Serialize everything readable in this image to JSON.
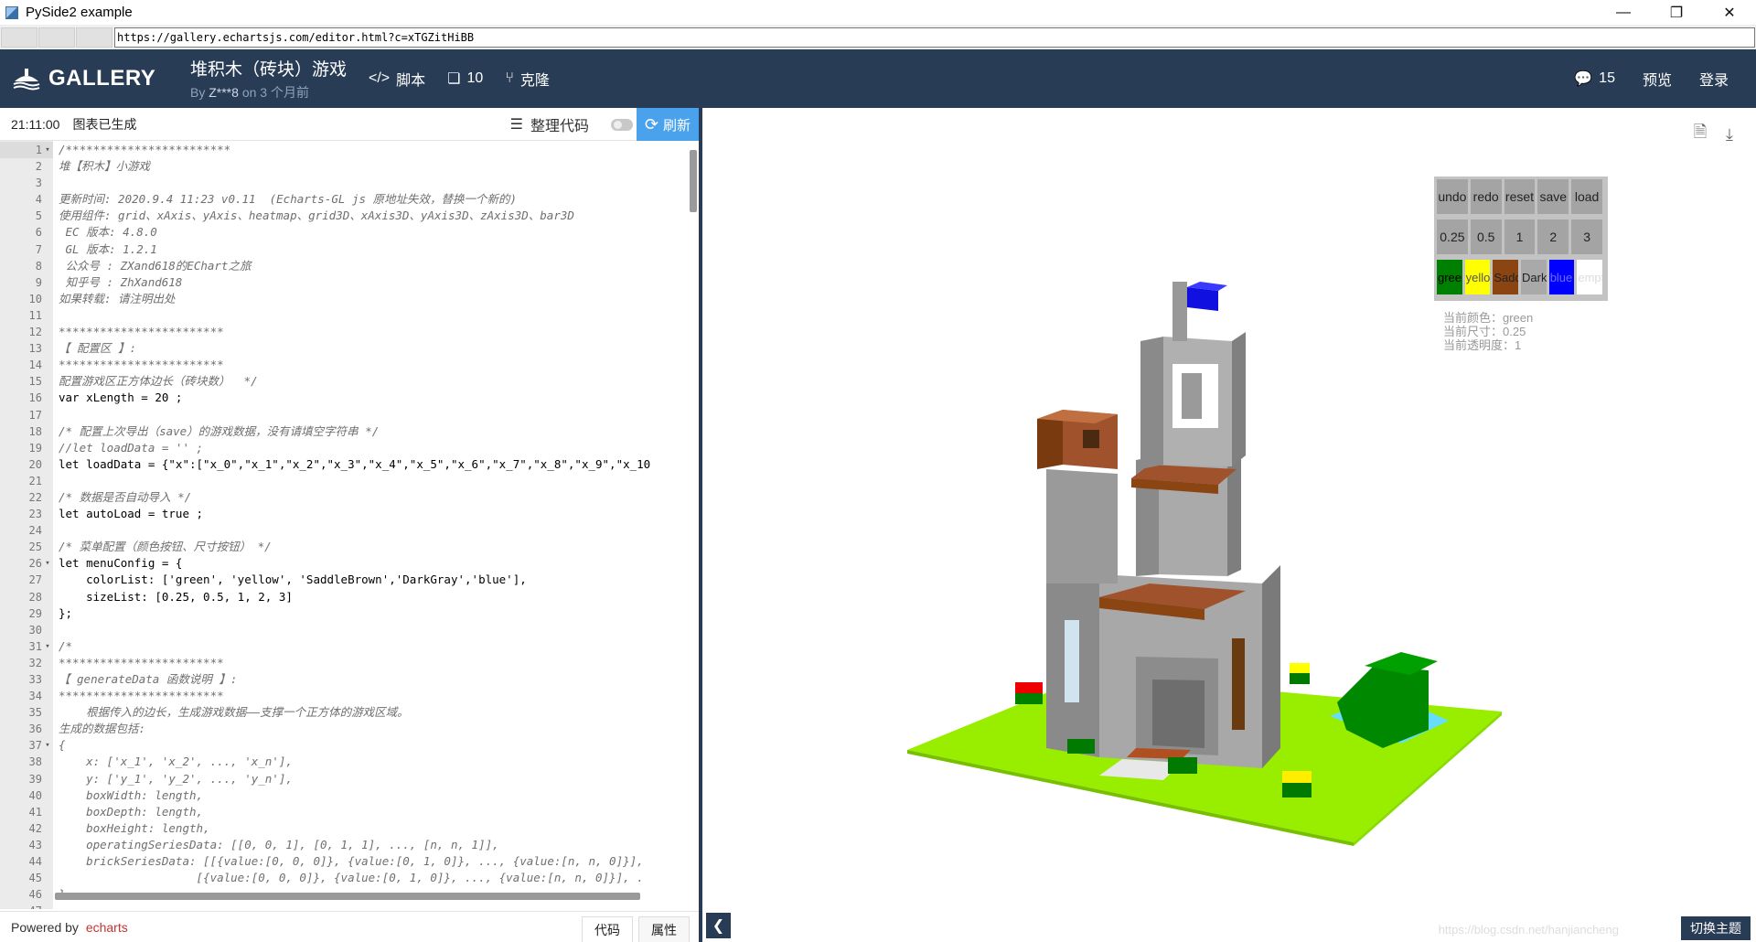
{
  "window": {
    "title": "PySide2 example",
    "minimize": "—",
    "maximize": "❐",
    "close": "✕"
  },
  "address": {
    "url": "https://gallery.echartsjs.com/editor.html?c=xTGZitHiBB"
  },
  "header": {
    "logo_text": "GALLERY",
    "title": "堆积木（砖块）游戏",
    "by_prefix": "By",
    "author": "Z***8",
    "time_suffix": "on 3 个月前",
    "script_label": "脚本",
    "count_label": "10",
    "clone_label": "克隆",
    "comments_count": "15",
    "preview_label": "预览",
    "login_label": "登录"
  },
  "editor": {
    "time": "21:11:00",
    "status": "图表已生成",
    "format_label": "整理代码",
    "refresh_label": "刷新",
    "powered_prefix": "Powered by",
    "powered_brand": "echarts",
    "tab_code": "代码",
    "tab_props": "属性",
    "lines": [
      {
        "n": "1",
        "f": "▾",
        "t": "/************************",
        "c": "cmt"
      },
      {
        "n": "2",
        "f": "",
        "t": "堆【积木】小游戏",
        "c": "cmt"
      },
      {
        "n": "3",
        "f": "",
        "t": "",
        "c": "cmt"
      },
      {
        "n": "4",
        "f": "",
        "t": "更新时间: 2020.9.4 11:23 v0.11  (Echarts-GL js 原地址失效，替换一个新的)",
        "c": "cmt"
      },
      {
        "n": "5",
        "f": "",
        "t": "使用组件: grid、xAxis、yAxis、heatmap、grid3D、xAxis3D、yAxis3D、zAxis3D、bar3D",
        "c": "cmt"
      },
      {
        "n": "6",
        "f": "",
        "t": " EC 版本: 4.8.0",
        "c": "cmt"
      },
      {
        "n": "7",
        "f": "",
        "t": " GL 版本: 1.2.1",
        "c": "cmt"
      },
      {
        "n": "8",
        "f": "",
        "t": " 公众号 : ZXand618的EChart之旅",
        "c": "cmt"
      },
      {
        "n": "9",
        "f": "",
        "t": " 知乎号 : ZhXand618",
        "c": "cmt"
      },
      {
        "n": "10",
        "f": "",
        "t": "如果转载: 请注明出处",
        "c": "cmt"
      },
      {
        "n": "11",
        "f": "",
        "t": "",
        "c": "cmt"
      },
      {
        "n": "12",
        "f": "",
        "t": "************************",
        "c": "cmt"
      },
      {
        "n": "13",
        "f": "",
        "t": "【 配置区 】:",
        "c": "cmt"
      },
      {
        "n": "14",
        "f": "",
        "t": "************************",
        "c": "cmt"
      },
      {
        "n": "15",
        "f": "",
        "t": "配置游戏区正方体边长（砖块数）  */",
        "c": "cmt"
      },
      {
        "n": "16",
        "f": "",
        "t": "var xLength = 20 ;",
        "c": "code"
      },
      {
        "n": "17",
        "f": "",
        "t": "",
        "c": "code"
      },
      {
        "n": "18",
        "f": "",
        "t": "/* 配置上次导出（save）的游戏数据，没有请填空字符串 */",
        "c": "cmt"
      },
      {
        "n": "19",
        "f": "",
        "t": "//let loadData = '' ;",
        "c": "cmt"
      },
      {
        "n": "20",
        "f": "",
        "t": "let loadData = {\"x\":[\"x_0\",\"x_1\",\"x_2\",\"x_3\",\"x_4\",\"x_5\",\"x_6\",\"x_7\",\"x_8\",\"x_9\",\"x_10",
        "c": "code"
      },
      {
        "n": "21",
        "f": "",
        "t": "",
        "c": "code"
      },
      {
        "n": "22",
        "f": "",
        "t": "/* 数据是否自动导入 */",
        "c": "cmt"
      },
      {
        "n": "23",
        "f": "",
        "t": "let autoLoad = true ;",
        "c": "code"
      },
      {
        "n": "24",
        "f": "",
        "t": "",
        "c": "code"
      },
      {
        "n": "25",
        "f": "",
        "t": "/* 菜单配置（颜色按钮、尺寸按钮） */",
        "c": "cmt"
      },
      {
        "n": "26",
        "f": "▾",
        "t": "let menuConfig = {",
        "c": "code"
      },
      {
        "n": "27",
        "f": "",
        "t": "    colorList: ['green', 'yellow', 'SaddleBrown','DarkGray','blue'],",
        "c": "code"
      },
      {
        "n": "28",
        "f": "",
        "t": "    sizeList: [0.25, 0.5, 1, 2, 3]",
        "c": "code"
      },
      {
        "n": "29",
        "f": "",
        "t": "};",
        "c": "code"
      },
      {
        "n": "30",
        "f": "",
        "t": "",
        "c": "code"
      },
      {
        "n": "31",
        "f": "▾",
        "t": "/*",
        "c": "cmt"
      },
      {
        "n": "32",
        "f": "",
        "t": "************************",
        "c": "cmt"
      },
      {
        "n": "33",
        "f": "",
        "t": "【 generateData 函数说明 】:",
        "c": "cmt"
      },
      {
        "n": "34",
        "f": "",
        "t": "************************",
        "c": "cmt"
      },
      {
        "n": "35",
        "f": "",
        "t": "    根据传入的边长，生成游戏数据——支撑一个正方体的游戏区域。",
        "c": "cmt"
      },
      {
        "n": "36",
        "f": "",
        "t": "生成的数据包括:",
        "c": "cmt"
      },
      {
        "n": "37",
        "f": "▾",
        "t": "{",
        "c": "cmt"
      },
      {
        "n": "38",
        "f": "",
        "t": "    x: ['x_1', 'x_2', ..., 'x_n'],",
        "c": "cmt"
      },
      {
        "n": "39",
        "f": "",
        "t": "    y: ['y_1', 'y_2', ..., 'y_n'],",
        "c": "cmt"
      },
      {
        "n": "40",
        "f": "",
        "t": "    boxWidth: length,",
        "c": "cmt"
      },
      {
        "n": "41",
        "f": "",
        "t": "    boxDepth: length,",
        "c": "cmt"
      },
      {
        "n": "42",
        "f": "",
        "t": "    boxHeight: length,",
        "c": "cmt"
      },
      {
        "n": "43",
        "f": "",
        "t": "    operatingSeriesData: [[0, 0, 1], [0, 1, 1], ..., [n, n, 1]],",
        "c": "cmt"
      },
      {
        "n": "44",
        "f": "",
        "t": "    brickSeriesData: [[{value:[0, 0, 0]}, {value:[0, 1, 0]}, ..., {value:[n, n, 0]}],",
        "c": "cmt"
      },
      {
        "n": "45",
        "f": "",
        "t": "                    [{value:[0, 0, 0]}, {value:[0, 1, 0]}, ..., {value:[n, n, 0]}], .",
        "c": "cmt"
      },
      {
        "n": "46",
        "f": "",
        "t": "}",
        "c": "cmt"
      },
      {
        "n": "47",
        "f": "",
        "t": "",
        "c": "cmt"
      }
    ]
  },
  "game_menu": {
    "row1": [
      "undo",
      "redo",
      "reset",
      "save",
      "load"
    ],
    "row2": [
      "0.25",
      "0.5",
      "1",
      "2",
      "3"
    ],
    "colors": [
      {
        "label": "green",
        "color": "#008000",
        "text": "#000"
      },
      {
        "label": "yellow",
        "color": "#ffff00",
        "text": "#555"
      },
      {
        "label": "SaddleBrown",
        "color": "#8b4513",
        "text": "#222"
      },
      {
        "label": "DarkGray",
        "color": "#a9a9a9",
        "text": "#222"
      },
      {
        "label": "blue",
        "color": "#0000ff",
        "text": "#6d6dff"
      },
      {
        "label": "empty",
        "color": "#ffffff",
        "text": "#ddd"
      }
    ],
    "current_color": "当前颜色：green",
    "current_size": "当前尺寸：0.25",
    "current_opacity": "当前透明度：1"
  },
  "preview": {
    "theme_label": "切换主题",
    "watermark": "https://blog.csdn.net/hanjiancheng"
  },
  "colors": {
    "header_bg": "#293c55",
    "refresh_bg": "#4aa2ec",
    "brand": "#c23531"
  }
}
